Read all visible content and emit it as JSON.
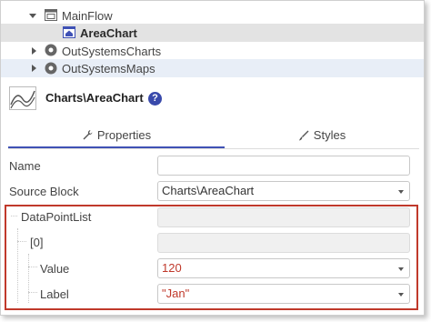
{
  "tree": {
    "items": [
      {
        "label": "MainFlow",
        "state": "expanded"
      },
      {
        "label": "AreaChart",
        "state": "selected"
      },
      {
        "label": "OutSystemsCharts",
        "state": "collapsed"
      },
      {
        "label": "OutSystemsMaps",
        "state": "collapsed"
      }
    ]
  },
  "header": {
    "title": "Charts\\AreaChart",
    "help_glyph": "?",
    "icon": "area-chart-icon"
  },
  "tabs": [
    {
      "label": "Properties",
      "icon": "wrench-icon",
      "active": true
    },
    {
      "label": "Styles",
      "icon": "brush-icon",
      "active": false
    }
  ],
  "properties": {
    "name": {
      "label": "Name",
      "value": ""
    },
    "source_block": {
      "label": "Source Block",
      "value": "Charts\\AreaChart"
    },
    "data_point_list": {
      "label": "DataPointList",
      "value": ""
    },
    "index0": {
      "label": "[0]",
      "value": ""
    },
    "value": {
      "label": "Value",
      "value": "120"
    },
    "label": {
      "label": "Label",
      "value": "\"Jan\""
    }
  },
  "colors": {
    "accent": "#3f51b5",
    "highlight_border": "#c0392b",
    "value_text": "#c0392b",
    "selected_row": "#e3e3e3"
  }
}
